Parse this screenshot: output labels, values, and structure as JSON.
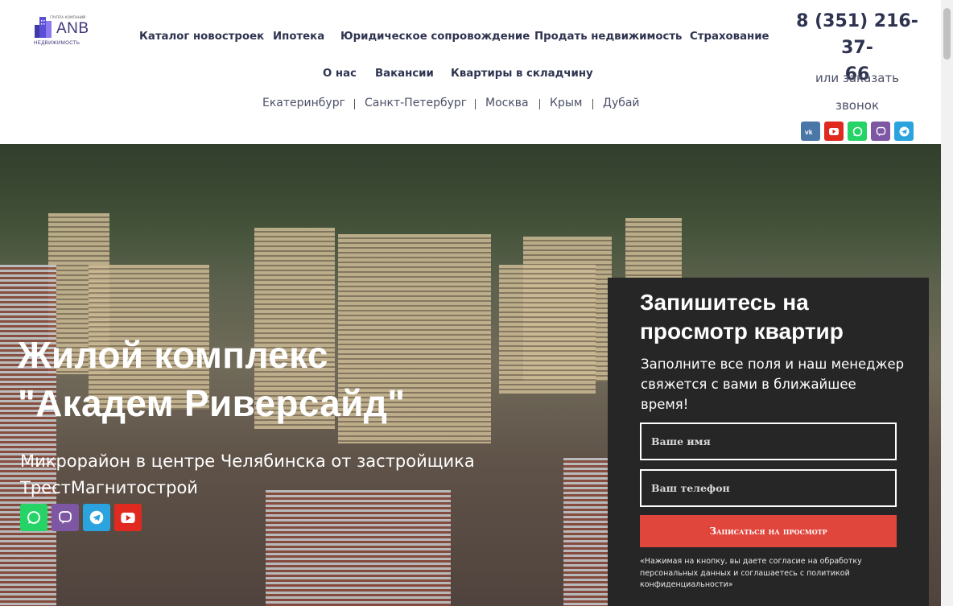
{
  "logo": {
    "small_text": "ГРУППА КОМПАНИЙ",
    "brand": "ANB",
    "sub": "НЕДВИЖИМОСТЬ"
  },
  "nav": {
    "primary": [
      "Каталог новостроек",
      "Ипотека",
      "Юридическое сопровождение",
      "Продать недвижимость",
      "Страхование"
    ],
    "secondary": [
      "О нас",
      "Вакансии",
      "Квартиры в складчину"
    ],
    "cities": [
      "Екатеринбург",
      "Санкт-Петербург",
      "Москва",
      "Крым",
      "Дубай"
    ]
  },
  "contact": {
    "phone_line1": "8 (351) 216-37-",
    "phone_line2": "66",
    "callback_line1": "или заказать",
    "callback_line2": "звонок"
  },
  "header_social": [
    "vk-icon",
    "youtube-icon",
    "whatsapp-icon",
    "viber-icon",
    "telegram-icon"
  ],
  "hero": {
    "title_line1": "Жилой комплекс",
    "title_line2": "\"Академ Риверсайд\"",
    "subtitle": "Микрорайон в центре Челябинска от застройщика ТрестМагнитострой",
    "social": [
      "whatsapp-icon",
      "viber-icon",
      "telegram-icon",
      "youtube-icon"
    ]
  },
  "form": {
    "title": "Запишитесь на просмотр квартир",
    "description": "Заполните все поля и наш менеджер свяжется с вами в ближайшее время!",
    "name_placeholder": "Ваше имя",
    "phone_placeholder": "Ваш телефон",
    "submit_label": "Записаться на просмотр",
    "consent": "«Нажимая на кнопку, вы даете согласие на обработку персональных данных и соглашаетесь с политикой конфиденциальности»"
  },
  "colors": {
    "nav_text": "#2e3350",
    "vk": "#4a76a8",
    "youtube": "#e02a20",
    "whatsapp": "#25d366",
    "viber": "#7d57a3",
    "telegram": "#2aa3de",
    "submit": "#e0463c",
    "form_bg": "#262626"
  }
}
